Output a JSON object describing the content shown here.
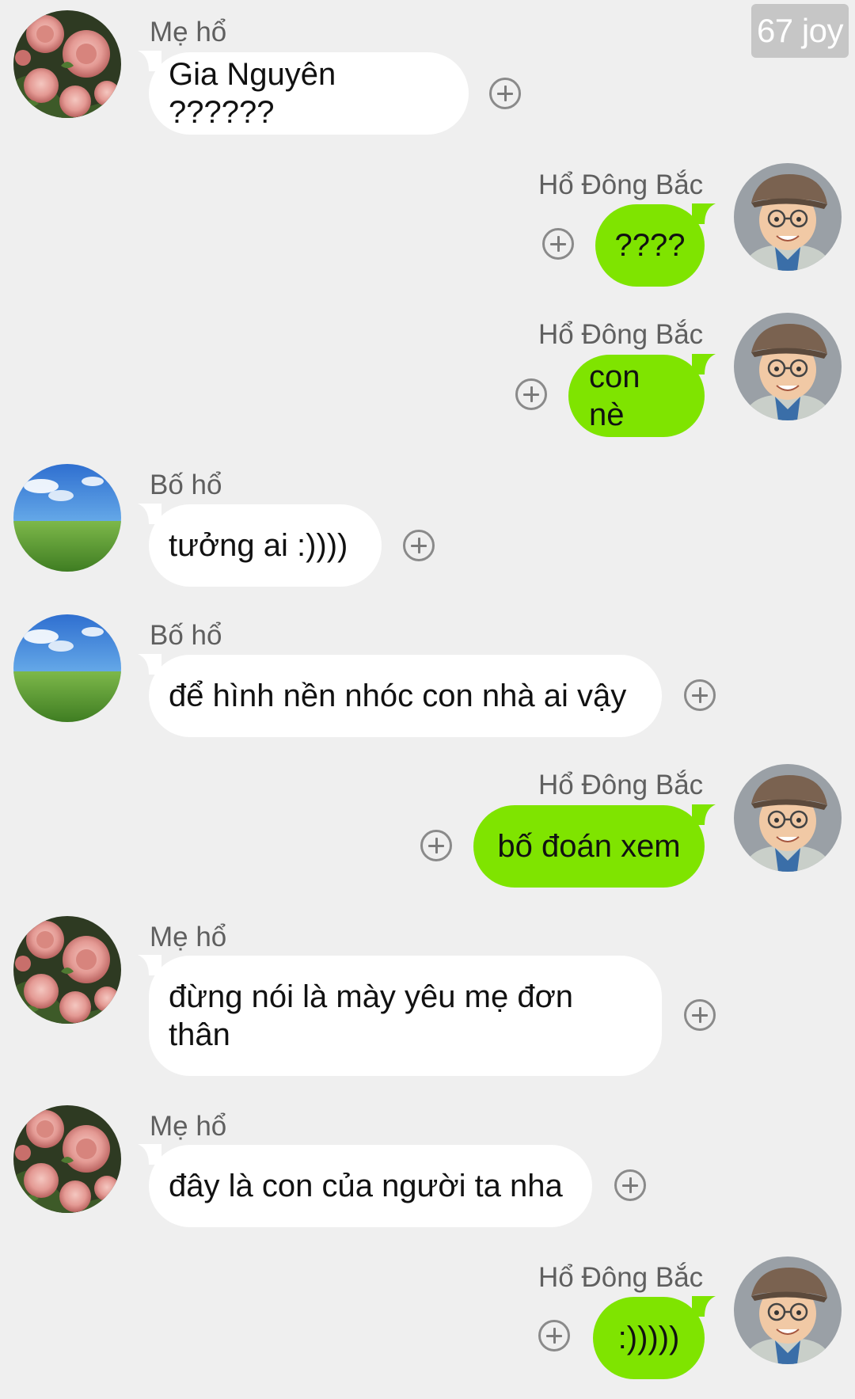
{
  "watermark": "67 joy",
  "colors": {
    "background": "#efefef",
    "incoming_bubble": "#ffffff",
    "outgoing_bubble": "#7fe400",
    "name_text": "#5f5f5f"
  },
  "avatars": {
    "me_ho": "roses-avatar",
    "bo_ho": "sky-grass-avatar",
    "self": "child-with-cap-avatar"
  },
  "messages": [
    {
      "sender": "Mẹ hổ",
      "text": "Gia Nguyên ??????",
      "side": "left"
    },
    {
      "sender": "Hổ Đông Bắc",
      "text": "????",
      "side": "right"
    },
    {
      "sender": "Hổ Đông Bắc",
      "text": "con nè",
      "side": "right"
    },
    {
      "sender": "Bố hổ",
      "text": "tưởng ai :))))",
      "side": "left"
    },
    {
      "sender": "Bố hổ",
      "text": "để hình nền nhóc con nhà ai vậy",
      "side": "left"
    },
    {
      "sender": "Hổ Đông Bắc",
      "text": "bố đoán xem",
      "side": "right"
    },
    {
      "sender": "Mẹ hổ",
      "text": "đừng nói là mày yêu mẹ đơn\nthân",
      "side": "left"
    },
    {
      "sender": "Mẹ hổ",
      "text": "đây là con của người ta nha",
      "side": "left"
    },
    {
      "sender": "Hổ Đông Bắc",
      "text": ":)))))",
      "side": "right"
    }
  ]
}
